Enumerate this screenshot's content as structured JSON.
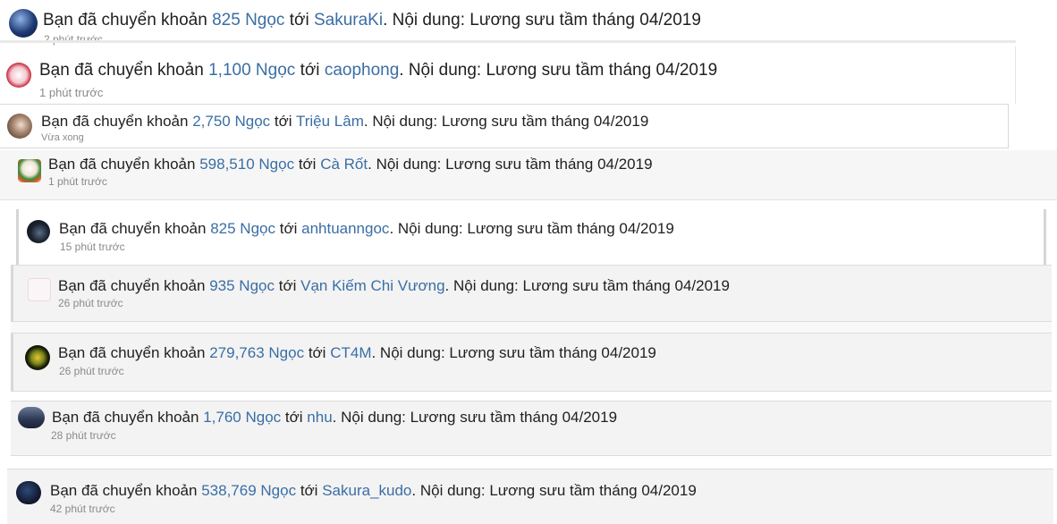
{
  "notifications": [
    {
      "prefix": "Bạn đã chuyển khoản",
      "amount": "825 Ngọc",
      "to_word": "tới",
      "recipient": "SakuraKi",
      "content": ". Nội dung: Lương sưu tầm tháng 04/2019",
      "time": "2 phút trước"
    },
    {
      "prefix": "Bạn đã chuyển khoản",
      "amount": "1,100 Ngọc",
      "to_word": "tới",
      "recipient": "caophong",
      "content": ". Nội dung: Lương sưu tầm tháng 04/2019",
      "time": "1 phút trước"
    },
    {
      "prefix": "Bạn đã chuyển khoản",
      "amount": "2,750 Ngọc",
      "to_word": "tới",
      "recipient": "Triệu Lâm",
      "content": ". Nội dung: Lương sưu tầm tháng 04/2019",
      "time": "Vừa xong"
    },
    {
      "prefix": "Bạn đã chuyển khoản",
      "amount": "598,510 Ngọc",
      "to_word": "tới",
      "recipient": "Cà Rốt",
      "content": ". Nội dung: Lương sưu tầm tháng 04/2019",
      "time": "1 phút trước"
    },
    {
      "prefix": "Bạn đã chuyển khoản",
      "amount": "825 Ngọc",
      "to_word": "tới",
      "recipient": "anhtuanngoc",
      "content": ". Nội dung: Lương sưu tầm tháng 04/2019",
      "time": "15 phút trước"
    },
    {
      "prefix": "Bạn đã chuyển khoản",
      "amount": "935 Ngọc",
      "to_word": "tới",
      "recipient": "Vạn Kiếm Chi Vương",
      "content": ". Nội dung: Lương sưu tầm tháng 04/2019",
      "time": "26 phút trước"
    },
    {
      "prefix": "Bạn đã chuyển khoản",
      "amount": "279,763 Ngọc",
      "to_word": "tới",
      "recipient": "CT4M",
      "content": ". Nội dung: Lương sưu tầm tháng 04/2019",
      "time": "26 phút trước"
    },
    {
      "prefix": "Bạn đã chuyển khoản",
      "amount": "1,760 Ngọc",
      "to_word": "tới",
      "recipient": "nhu",
      "content": ". Nội dung: Lương sưu tầm tháng 04/2019",
      "time": "28 phút trước"
    },
    {
      "prefix": "Bạn đã chuyển khoản",
      "amount": "538,769 Ngọc",
      "to_word": "tới",
      "recipient": "Sakura_kudo",
      "content": ". Nội dung: Lương sưu tầm tháng 04/2019",
      "time": "42 phút trước"
    }
  ],
  "colors": {
    "link": "#3a6ea5",
    "text": "#1f1f1f",
    "muted": "#8a8a8a"
  }
}
